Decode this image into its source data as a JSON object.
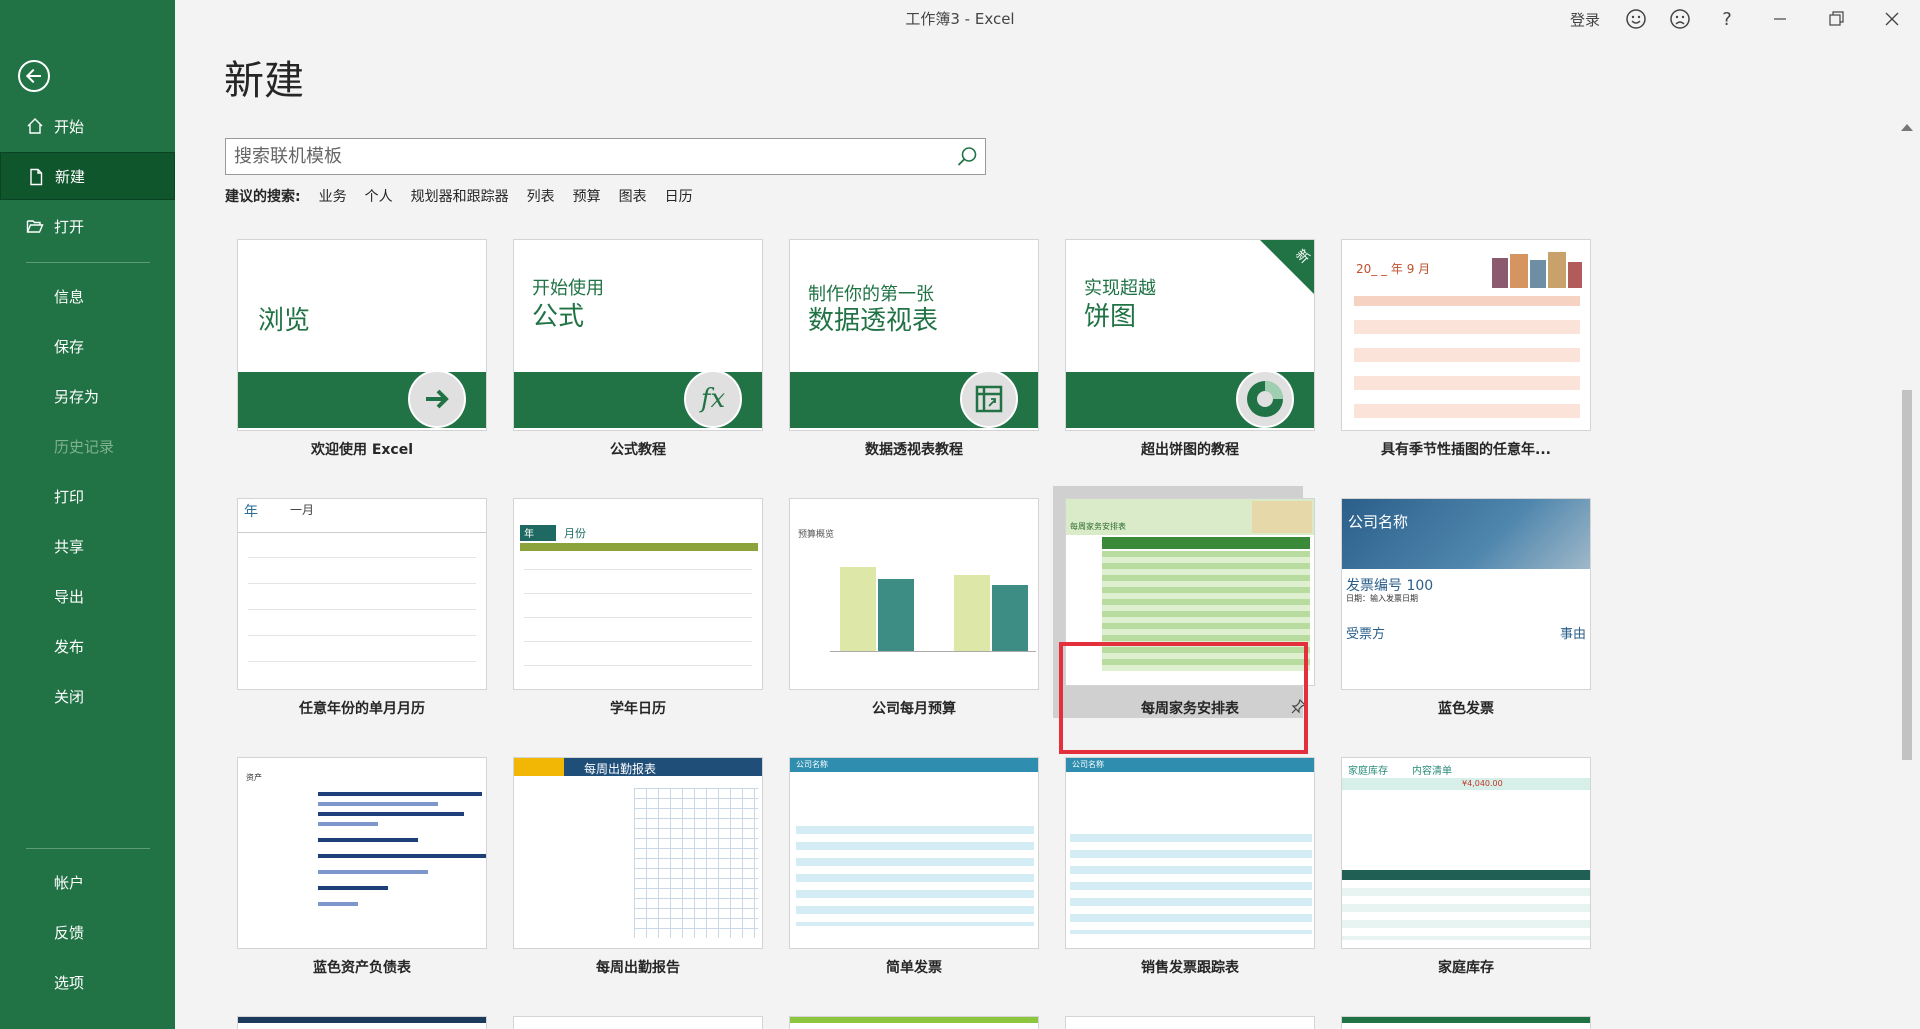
{
  "window": {
    "title": "工作簿3  -  Excel"
  },
  "topbar": {
    "signin": "登录"
  },
  "sidebar": {
    "items": [
      {
        "label": "开始"
      },
      {
        "label": "新建"
      },
      {
        "label": "打开"
      },
      {
        "label": "信息"
      },
      {
        "label": "保存"
      },
      {
        "label": "另存为"
      },
      {
        "label": "历史记录"
      },
      {
        "label": "打印"
      },
      {
        "label": "共享"
      },
      {
        "label": "导出"
      },
      {
        "label": "发布"
      },
      {
        "label": "关闭"
      },
      {
        "label": "帐户"
      },
      {
        "label": "反馈"
      },
      {
        "label": "选项"
      }
    ]
  },
  "main": {
    "title": "新建",
    "search": {
      "placeholder": "搜索联机模板",
      "value": ""
    },
    "suggested": {
      "label": "建议的搜索:",
      "links": [
        "业务",
        "个人",
        "规划器和跟踪器",
        "列表",
        "预算",
        "图表",
        "日历"
      ]
    },
    "templates": [
      {
        "label": "欢迎使用 Excel",
        "thumb_text": "浏览"
      },
      {
        "label": "公式教程",
        "thumb_line1": "开始使用",
        "thumb_line2": "公式",
        "icon_text": "fx"
      },
      {
        "label": "数据透视表教程",
        "thumb_line1": "制作你的第一张",
        "thumb_line2": "数据透视表"
      },
      {
        "label": "超出饼图的教程",
        "thumb_line1": "实现超越",
        "thumb_line2": "饼图",
        "corner_badge": "新"
      },
      {
        "label": "具有季节性插图的任意年...",
        "thumb_heading": "20_ _ 年 9 月"
      },
      {
        "label": "任意年份的单月月历",
        "thumb_year": "年",
        "thumb_month": "一月"
      },
      {
        "label": "学年日历",
        "thumb_year": "年",
        "thumb_month": "月份"
      },
      {
        "label": "公司每月预算",
        "thumb_heading": "预算概览"
      },
      {
        "label": "每周家务安排表",
        "thumb_heading": "每周家务安排表"
      },
      {
        "label": "蓝色发票",
        "thumb_company": "公司名称",
        "thumb_invoice": "发票编号 100",
        "thumb_date": "日期：输入发票日期",
        "thumb_to": "受票方",
        "thumb_reason": "事由"
      },
      {
        "label": "蓝色资产负债表",
        "thumb_heading": "资产"
      },
      {
        "label": "每周出勤报告",
        "thumb_heading": "每周出勤报表"
      },
      {
        "label": "简单发票",
        "thumb_heading": "公司名称"
      },
      {
        "label": "销售发票跟踪表",
        "thumb_heading": "公司名称"
      },
      {
        "label": "家庭库存",
        "thumb_heading": "家庭库存",
        "thumb_sub": "内容清单",
        "thumb_value": "¥4,040.00"
      }
    ]
  },
  "colors": {
    "excel_green": "#217346",
    "selection_border": "#e3303c"
  }
}
